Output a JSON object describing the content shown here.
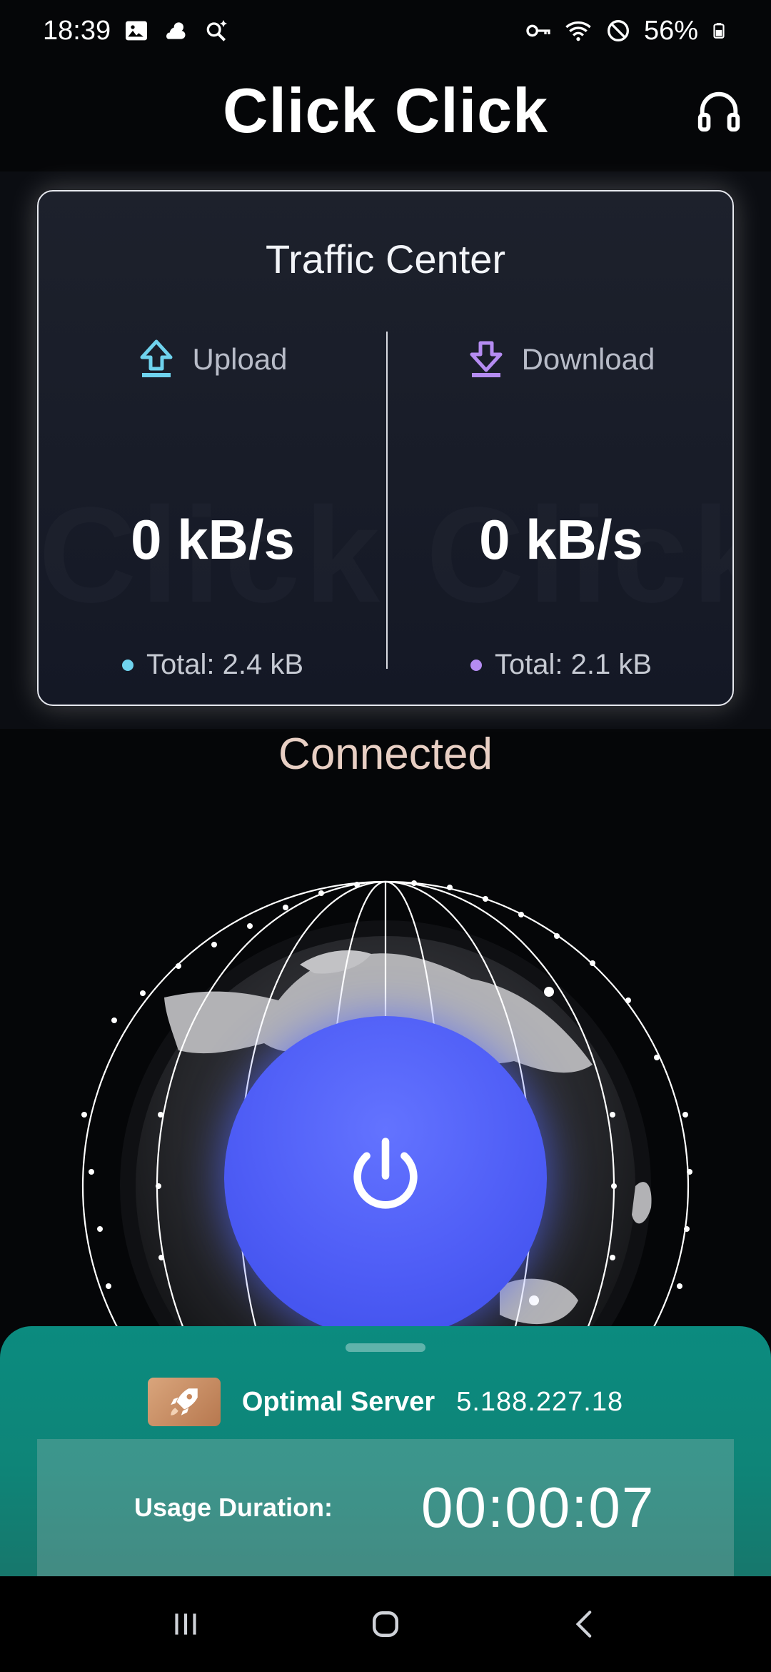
{
  "status_bar": {
    "time": "18:39",
    "battery": "56%"
  },
  "header": {
    "title": "Click Click"
  },
  "traffic": {
    "title": "Traffic Center",
    "watermark": "Click Click",
    "upload": {
      "label": "Upload",
      "rate": "0 kB/s",
      "total": "Total: 2.4 kB",
      "color": "#6fd3ee"
    },
    "download": {
      "label": "Download",
      "rate": "0 kB/s",
      "total": "Total: 2.1 kB",
      "color": "#b58cf2"
    }
  },
  "connection": {
    "status": "Connected"
  },
  "server": {
    "label": "Optimal Server",
    "ip": "5.188.227.18"
  },
  "usage": {
    "label": "Usage Duration:",
    "value": "00:00:07"
  },
  "colors": {
    "accent": "#4e5df6",
    "sheet": "#0b8b7f"
  }
}
